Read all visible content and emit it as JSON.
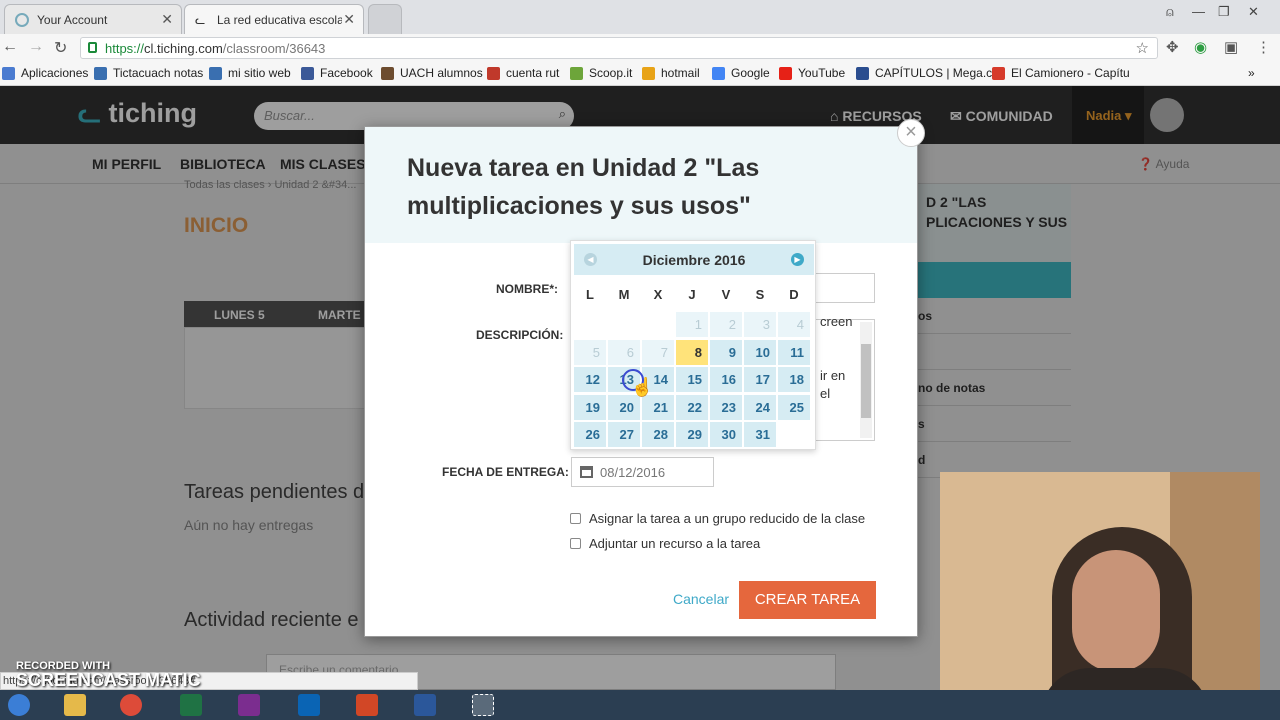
{
  "browser": {
    "tabs": [
      {
        "title": "Your Account"
      },
      {
        "title": "La red educativa escolar"
      }
    ],
    "url": {
      "scheme": "https://",
      "host": "cl.tiching.com",
      "path": "/classroom/36643"
    },
    "bookmarks": [
      {
        "label": "Aplicaciones",
        "color": "#4a7bd0"
      },
      {
        "label": "Tictacuach notas",
        "color": "#3a6fb0"
      },
      {
        "label": "mi sitio web",
        "color": "#3a6fb0"
      },
      {
        "label": "Facebook",
        "color": "#3b5998"
      },
      {
        "label": "UACH alumnos",
        "color": "#6d4c2f"
      },
      {
        "label": "cuenta rut",
        "color": "#c0392b"
      },
      {
        "label": "Scoop.it",
        "color": "#6da53a"
      },
      {
        "label": "hotmail",
        "color": "#e8a317"
      },
      {
        "label": "Google",
        "color": "#4285f4"
      },
      {
        "label": "YouTube",
        "color": "#e62117"
      },
      {
        "label": "CAPÍTULOS | Mega.cl",
        "color": "#2a4d8f"
      },
      {
        "label": "El Camionero - Capítu",
        "color": "#d63a2a"
      }
    ]
  },
  "site": {
    "logo": "tiching",
    "search_placeholder": "Buscar...",
    "header_links": {
      "recursos": "RECURSOS",
      "comunidad": "COMUNIDAD"
    },
    "user": "Nadia",
    "subnav": [
      "MI PERFIL",
      "BIBLIOTECA",
      "MIS CLASES"
    ],
    "help": "Ayuda",
    "breadcrumb": "Todas las clases  ›  Unidad 2 &#34...",
    "inicio": "INICIO",
    "calendar_cols": [
      "LUNES 5",
      "MARTE"
    ],
    "tareas_pendientes": "Tareas pendientes d",
    "no_entregas": "Aún no hay entregas",
    "actividad": "Actividad reciente e",
    "comment_placeholder": "Escribe un comentario...",
    "right_panel": {
      "title": "D 2 \"LAS\nPLICACIONES Y SUS",
      "items": [
        "os",
        "",
        "no de notas",
        "s",
        "d"
      ]
    }
  },
  "modal": {
    "title": "Nueva tarea en Unidad 2 \"Las multiplicaciones y sus usos\"",
    "close": "×",
    "nombre_label": "NOMBRE*:",
    "descripcion_label": "DESCRIPCIÓN:",
    "descripcion_fragments": [
      "creen",
      "ir en",
      "el"
    ],
    "fecha_label": "FECHA DE ENTREGA:",
    "fecha_value": "08/12/2016",
    "checkbox1": "Asignar la tarea a un grupo reducido de la clase",
    "checkbox2": "Adjuntar un recurso a la tarea",
    "cancel": "Cancelar",
    "submit": "CREAR TAREA"
  },
  "datepicker": {
    "month_title": "Diciembre 2016",
    "weekdays": [
      "L",
      "M",
      "X",
      "J",
      "V",
      "S",
      "D"
    ],
    "rows": [
      [
        null,
        null,
        null,
        {
          "d": "1",
          "o": true
        },
        {
          "d": "2",
          "o": true
        },
        {
          "d": "3",
          "o": true
        },
        {
          "d": "4",
          "o": true
        }
      ],
      [
        {
          "d": "5",
          "o": true
        },
        {
          "d": "6",
          "o": true
        },
        {
          "d": "7",
          "o": true
        },
        {
          "d": "8",
          "t": true
        },
        {
          "d": "9"
        },
        {
          "d": "10"
        },
        {
          "d": "11"
        }
      ],
      [
        {
          "d": "12"
        },
        {
          "d": "13"
        },
        {
          "d": "14"
        },
        {
          "d": "15"
        },
        {
          "d": "16"
        },
        {
          "d": "17"
        },
        {
          "d": "18"
        }
      ],
      [
        {
          "d": "19"
        },
        {
          "d": "20"
        },
        {
          "d": "21"
        },
        {
          "d": "22"
        },
        {
          "d": "23"
        },
        {
          "d": "24"
        },
        {
          "d": "25"
        }
      ],
      [
        {
          "d": "26"
        },
        {
          "d": "27"
        },
        {
          "d": "28"
        },
        {
          "d": "29"
        },
        {
          "d": "30"
        },
        {
          "d": "31"
        },
        null
      ]
    ]
  },
  "status_url": "https://cl.tiching.com/classroom/36643#",
  "watermark": {
    "line1": "RECORDED WITH",
    "line2": "SCREENCAST  MATIC"
  }
}
